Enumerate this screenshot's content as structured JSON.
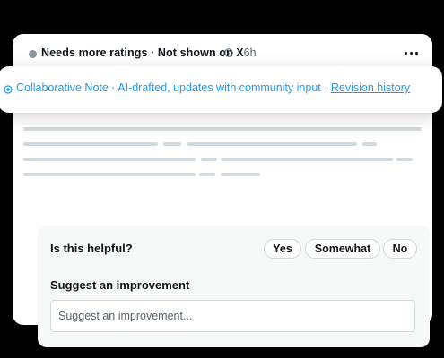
{
  "header": {
    "status": "Needs more ratings · Not shown on X",
    "time": "· 6h",
    "status_dot_color": "#8b98a5",
    "info_icon": "info-icon",
    "more_icon": "more-icon"
  },
  "banner": {
    "icon": "target-icon",
    "text": "Collaborative Note · AI-drafted, updates with community input · ",
    "link": "Revision history",
    "accent_color": "#1d9bf0"
  },
  "feedback": {
    "question": "Is this helpful?",
    "options": [
      "Yes",
      "Somewhat",
      "No"
    ],
    "suggest_title": "Suggest an improvement",
    "suggest_placeholder": "Suggest an improvement..."
  }
}
